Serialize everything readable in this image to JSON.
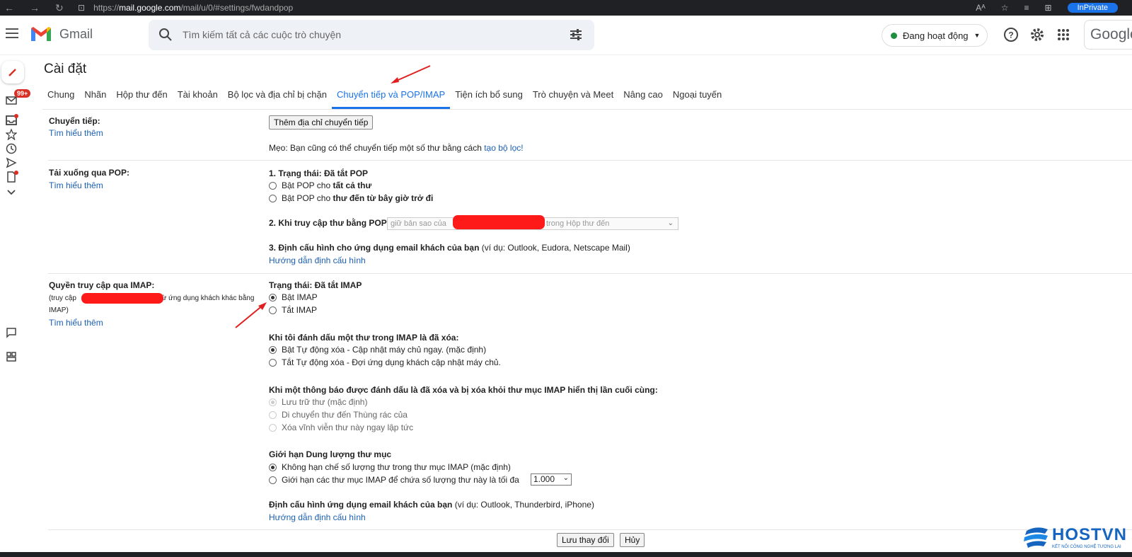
{
  "browser": {
    "url_prefix": "https://",
    "url_host": "mail.google.com",
    "url_path": "/mail/u/0/#settings/fwdandpop",
    "reader_label": "Aᴬ",
    "inprivate": "InPrivate"
  },
  "header": {
    "app_name": "Gmail",
    "search_placeholder": "Tìm kiếm tất cả các cuộc trò chuyện",
    "status": "Đang hoạt động",
    "google_label": "Google",
    "badge": "99+"
  },
  "page": {
    "title": "Cài đặt",
    "tabs": [
      {
        "label": "Chung"
      },
      {
        "label": "Nhãn"
      },
      {
        "label": "Hộp thư đến"
      },
      {
        "label": "Tài khoản"
      },
      {
        "label": "Bộ lọc và địa chỉ bị chặn"
      },
      {
        "label": "Chuyển tiếp và POP/IMAP"
      },
      {
        "label": "Tiện ích bổ sung"
      },
      {
        "label": "Trò chuyện và Meet"
      },
      {
        "label": "Nâng cao"
      },
      {
        "label": "Ngoại tuyến"
      }
    ]
  },
  "forwarding": {
    "label": "Chuyển tiếp:",
    "learn_more": "Tìm hiểu thêm",
    "add_button": "Thêm địa chỉ chuyển tiếp",
    "tip_text": "Mẹo: Bạn cũng có thể chuyển tiếp một số thư bằng cách ",
    "tip_link": "tạo bộ lọc!"
  },
  "pop": {
    "label": "Tải xuống qua POP:",
    "learn_more": "Tìm hiểu thêm",
    "status": "1. Trạng thái: Đã tắt POP",
    "opt1_prefix": "Bật POP cho ",
    "opt1_bold": "tất cả thư",
    "opt2_prefix": "Bật POP cho ",
    "opt2_bold": "thư đến từ bây giờ trở đi",
    "access_label": "2. Khi truy cập thư bằng POP",
    "access_select": "giữ bản sao của",
    "access_select_suffix": "trong Hộp thư đến",
    "config_bold": "3. Định cấu hình cho ứng dụng email khách của bạn",
    "config_rest": " (ví dụ: Outlook, Eudora, Netscape Mail)",
    "config_link": "Hướng dẫn định cấu hình"
  },
  "imap": {
    "label": "Quyền truy cập qua IMAP:",
    "desc_prefix": "(truy cập",
    "desc_suffix": "từ ứng dụng khách khác bằng",
    "desc_line2": "IMAP)",
    "learn_more": "Tìm hiểu thêm",
    "status": "Trạng thái: Đã tắt IMAP",
    "enable": "Bật IMAP",
    "disable": "Tắt IMAP",
    "delete_heading": "Khi tôi đánh dấu một thư trong IMAP là đã xóa:",
    "delete_opt1": "Bật Tự động xóa - Cập nhật máy chủ ngay. (mặc định)",
    "delete_opt2": "Tắt Tự động xóa - Đợi ứng dụng khách cập nhật máy chủ.",
    "expunge_heading": "Khi một thông báo được đánh dấu là đã xóa và bị xóa khỏi thư mục IMAP hiển thị lần cuối cùng:",
    "expunge_opt1": "Lưu trữ thư (mặc định)",
    "expunge_opt2": "Di chuyển thư đến Thùng rác của",
    "expunge_opt3": "Xóa vĩnh viễn thư này ngay lập tức",
    "limit_heading": "Giới hạn Dung lượng thư mục",
    "limit_opt1": "Không hạn chế số lượng thư trong thư mục IMAP (mặc định)",
    "limit_opt2": "Giới hạn các thư mục IMAP để chứa số lượng thư này là tối đa",
    "limit_value": "1.000",
    "config_bold": "Định cấu hình ứng dụng email khách của bạn",
    "config_rest": " (ví dụ: Outlook, Thunderbird, iPhone)",
    "config_link": "Hướng dẫn định cấu hình"
  },
  "actions": {
    "save": "Lưu thay đổi",
    "cancel": "Hủy"
  },
  "watermark": {
    "brand": "HOSTVN",
    "tagline": "KẾT NỐI CÔNG NGHỆ TƯƠNG LAI"
  },
  "colors": {
    "accent": "#1a73e8",
    "link": "#1a5fb4",
    "redaction": "#ff1a1a",
    "annotation_arrow": "#e02020"
  }
}
